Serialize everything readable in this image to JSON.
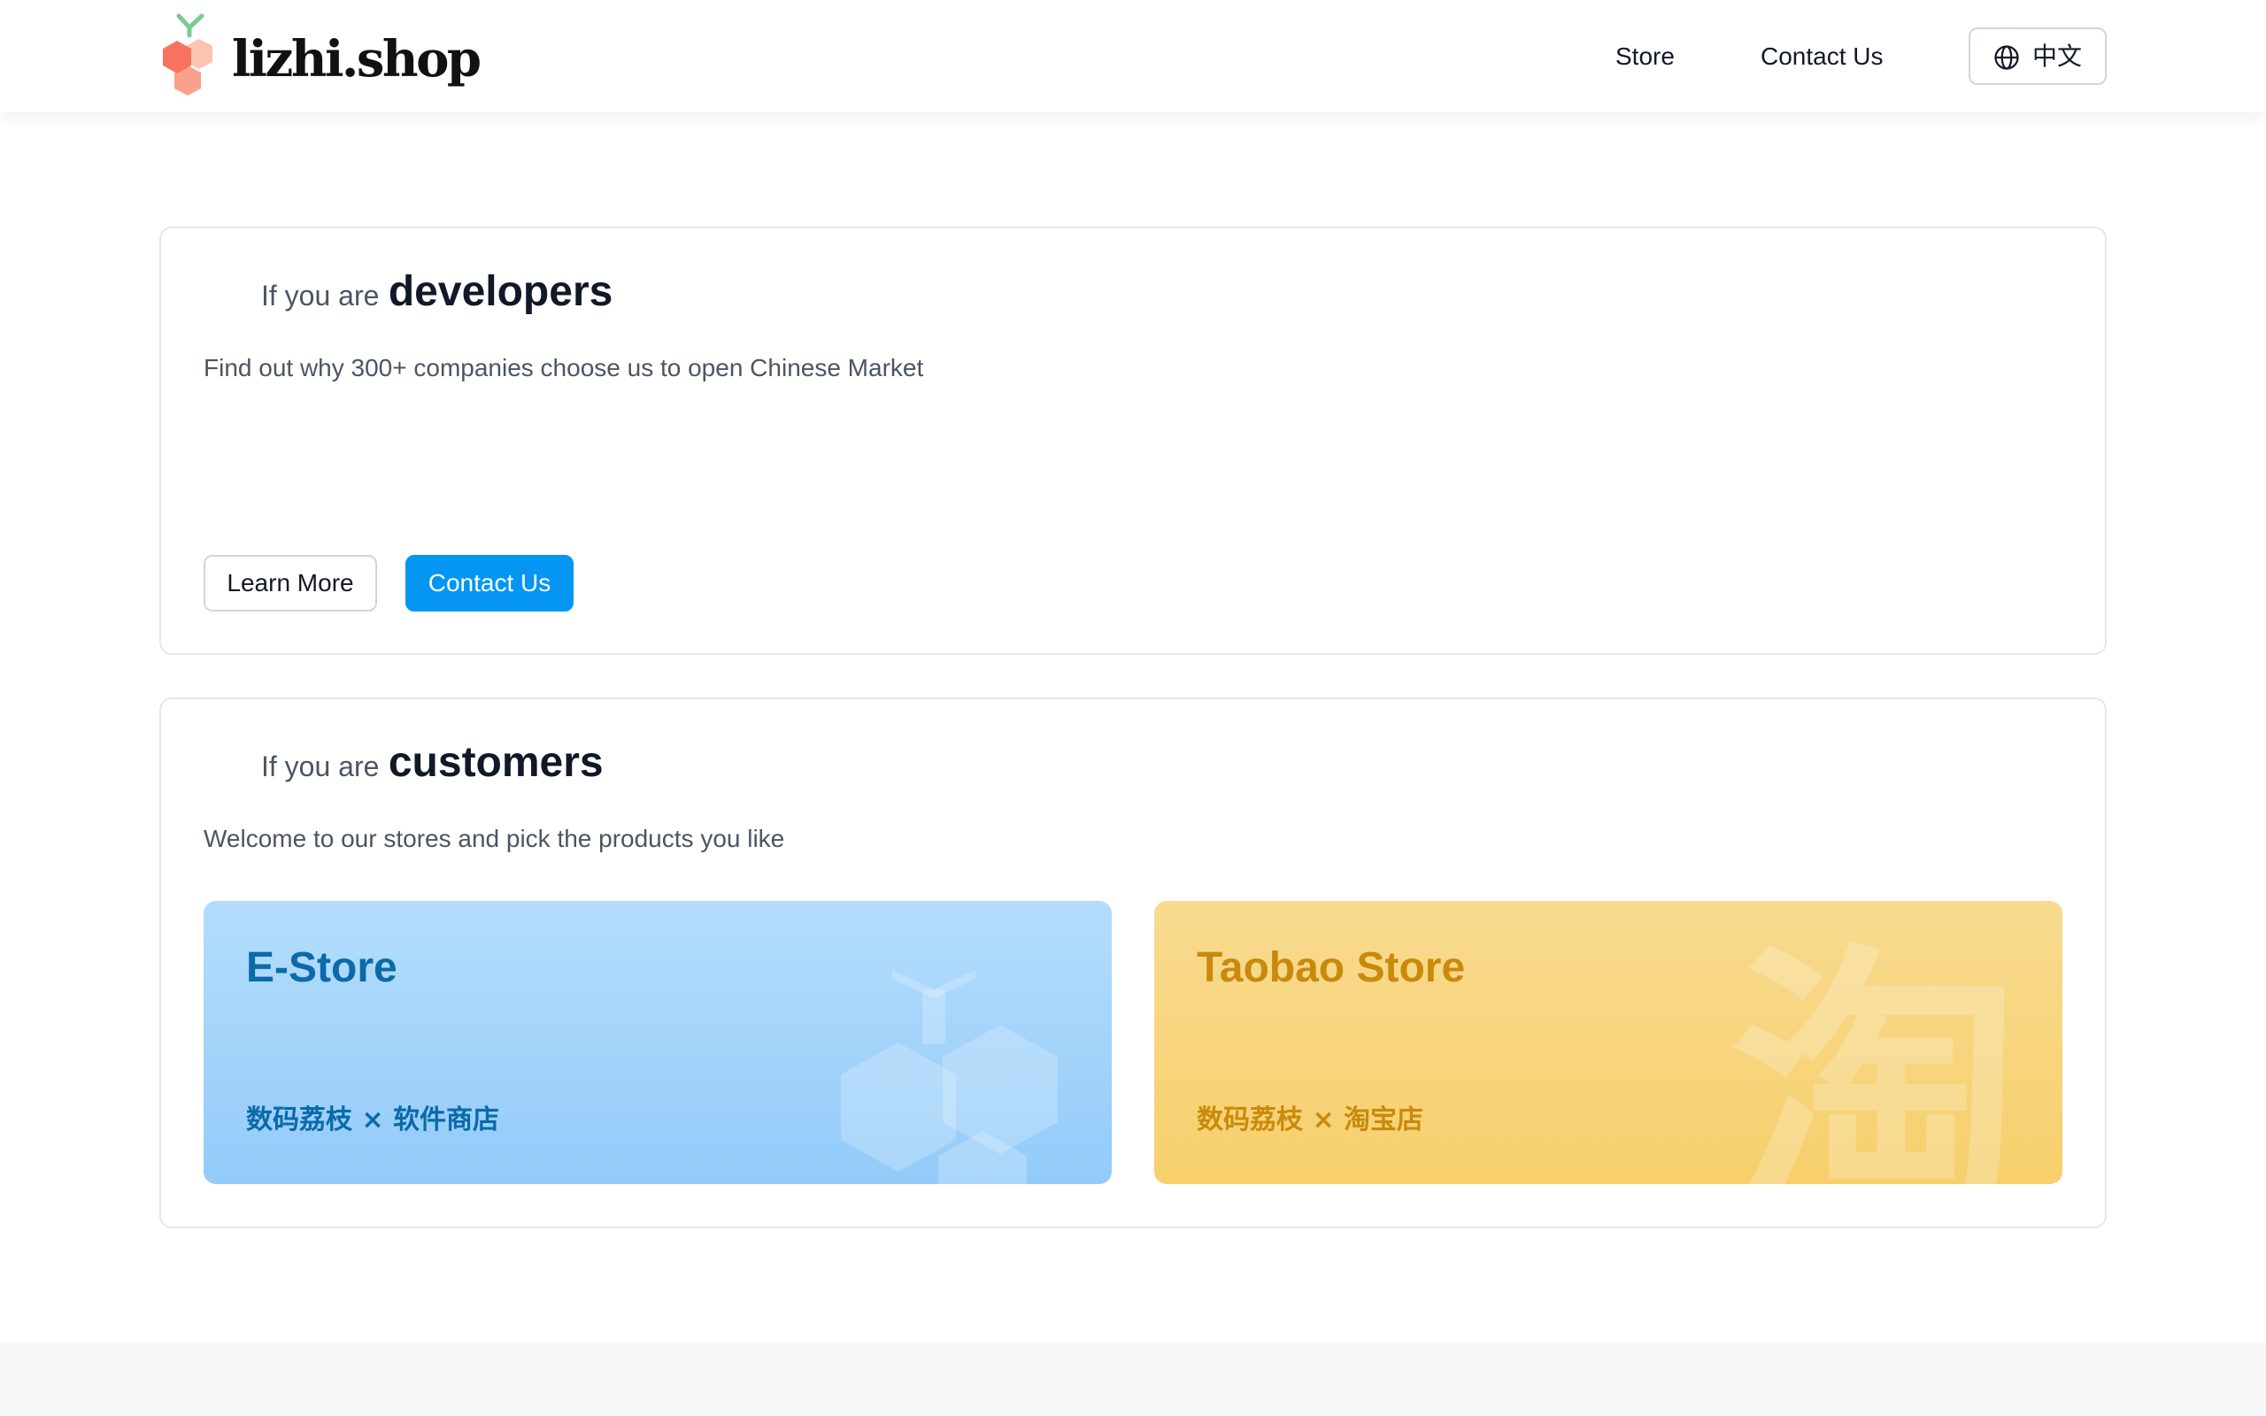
{
  "header": {
    "brand_name": "lizhi.shop",
    "logo_icon": "lychee-hexagon-logo-icon",
    "nav": {
      "store_label": "Store",
      "contact_label": "Contact Us"
    },
    "language": {
      "icon": "globe-icon",
      "label": "中文"
    }
  },
  "developers": {
    "prefix": "If you are",
    "audience": "developers",
    "description": "Find out why 300+ companies choose us to open Chinese Market",
    "learn_more_label": "Learn More",
    "contact_label": "Contact Us"
  },
  "customers": {
    "prefix": "If you are",
    "audience": "customers",
    "description": "Welcome to our stores and pick the products you like",
    "stores": [
      {
        "title": "E-Store",
        "subtitle": "数码荔枝 × 软件商店",
        "watermark_icon": "hexagon-lychee-icon",
        "color": "#0b6aa8",
        "background": "#a9d6fb"
      },
      {
        "title": "Taobao Store",
        "subtitle": "数码荔枝 × 淘宝店",
        "watermark_icon": "tao-character-icon",
        "watermark_glyph": "淘",
        "color": "#c98a0c",
        "background": "#f7d37a"
      }
    ]
  },
  "colors": {
    "primary_button": "#0496f2",
    "heading": "#111827",
    "muted_text": "#4b5563",
    "border": "#e5e7eb",
    "logo_red": "#f8735f",
    "logo_peach": "#fbb59f",
    "logo_leaf": "#7cc995"
  }
}
